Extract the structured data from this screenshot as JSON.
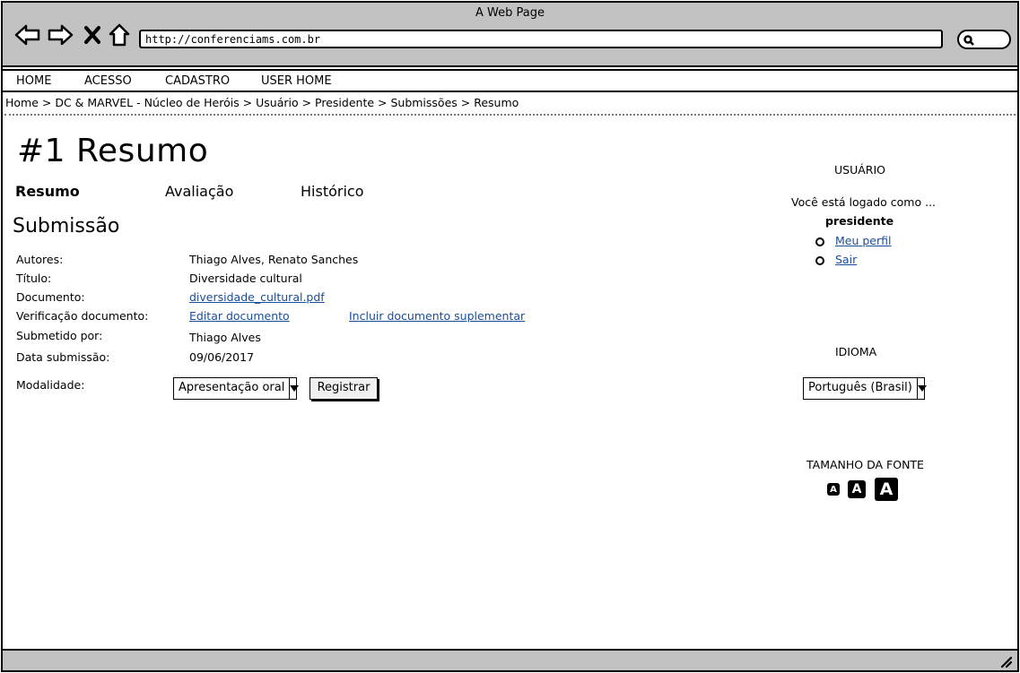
{
  "browser": {
    "title": "A Web Page",
    "url": "http://conferenciams.com.br"
  },
  "menu": {
    "items": [
      "HOME",
      "ACESSO",
      "CADASTRO",
      "USER HOME"
    ]
  },
  "breadcrumb": "Home > DC & MARVEL - Núcleo de Heróis  > Usuário > Presidente > Submissões > Resumo",
  "page": {
    "title": "#1 Resumo",
    "tabs": [
      "Resumo",
      "Avaliação",
      "Histórico"
    ],
    "section_title": "Submissão"
  },
  "submission": {
    "authors_label": "Autores:",
    "authors": "Thiago Alves, Renato Sanches",
    "title_label": "Título:",
    "title": "Diversidade cultural",
    "document_label": "Documento:",
    "document": "diversidade_cultural.pdf",
    "verification_label": "Verificação documento:",
    "edit_link": "Editar documento",
    "supplementary_link": "Incluir documento suplementar",
    "submitted_by_label": "Submetido por:",
    "submitted_by": "Thiago Alves",
    "date_label": "Data submissão:",
    "date": "09/06/2017",
    "modality_label": "Modalidade:",
    "modality_selected": "Apresentação oral",
    "register_button": "Registrar"
  },
  "sidebar": {
    "user_heading": "USUÁRIO",
    "logged_text": "Você está logado  como ...",
    "username": "presidente",
    "profile_link": "Meu perfil",
    "logout_link": "Sair",
    "language_heading": "IDIOMA",
    "language_selected": "Português (Brasil)",
    "font_size_heading": "TAMANHO DA FONTE",
    "font_letter": "A"
  }
}
